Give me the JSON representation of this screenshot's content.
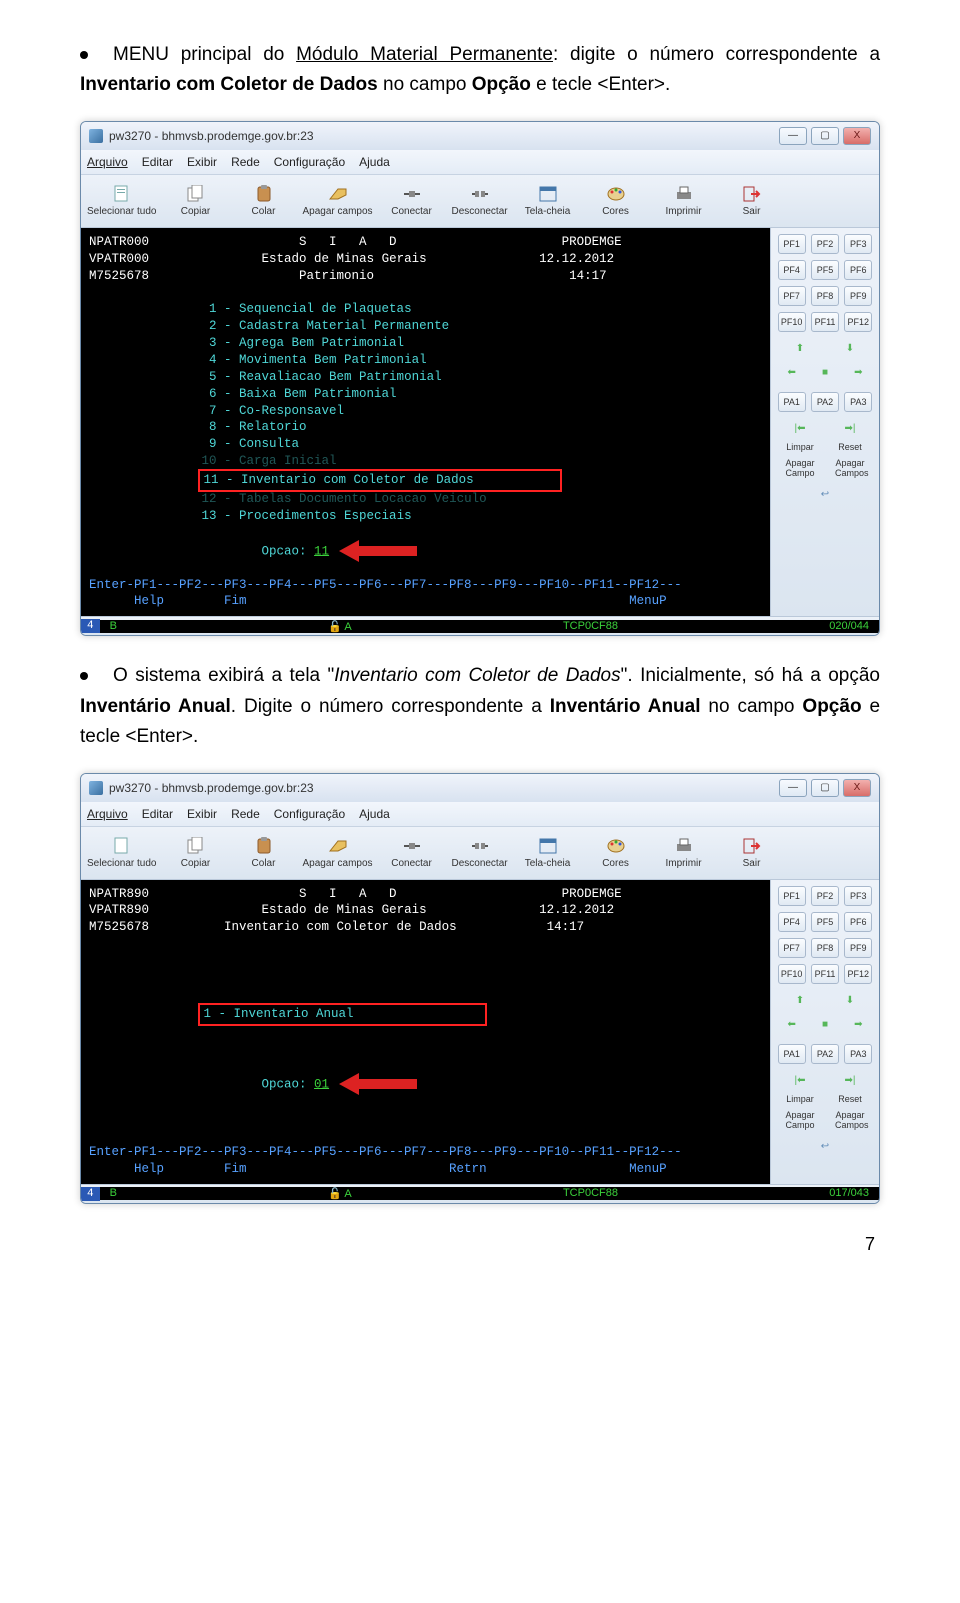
{
  "intro1": {
    "prefix": "MENU principal do ",
    "module": "Módulo Material Permanente",
    "mid": ": digite o número correspondente a ",
    "feature": "Inventario com Coletor de Dados",
    "campo": " no campo ",
    "opt": "Opção",
    "suffix": " e tecle <Enter>."
  },
  "intro2": {
    "p1": "O sistema exibirá a tela \"",
    "name": "Inventario com Coletor de Dados",
    "p2": "\". Inicialmente, só há a opção ",
    "anual": "Inventário Anual",
    "p3": ". Digite o número correspondente a ",
    "anual2": "Inventário Anual",
    "p4": " no campo ",
    "opt": "Opção",
    "p5": " e tecle <Enter>."
  },
  "window": {
    "title": "pw3270 - bhmvsb.prodemge.gov.br:23",
    "menubar": [
      "Arquivo",
      "Editar",
      "Exibir",
      "Rede",
      "Configuração",
      "Ajuda"
    ],
    "toolbar": [
      {
        "label": "Selecionar tudo",
        "svg": "doc"
      },
      {
        "label": "Copiar",
        "svg": "copy"
      },
      {
        "label": "Colar",
        "svg": "paste"
      },
      {
        "label": "Apagar campos",
        "svg": "eraser"
      },
      {
        "label": "Conectar",
        "svg": "plug"
      },
      {
        "label": "Desconectar",
        "svg": "unplug"
      },
      {
        "label": "Tela-cheia",
        "svg": "fullscreen"
      },
      {
        "label": "Cores",
        "svg": "palette"
      },
      {
        "label": "Imprimir",
        "svg": "print"
      },
      {
        "label": "Sair",
        "svg": "exit"
      }
    ],
    "side": {
      "pf": [
        [
          "PF1",
          "PF2",
          "PF3"
        ],
        [
          "PF4",
          "PF5",
          "PF6"
        ],
        [
          "PF7",
          "PF8",
          "PF9"
        ],
        [
          "PF10",
          "PF11",
          "PF12"
        ]
      ],
      "pa": [
        "PA1",
        "PA2",
        "PA3"
      ],
      "labels1": [
        "Limpar",
        "Reset"
      ],
      "labels2": [
        "Apagar Campo",
        "Apagar Campos"
      ]
    },
    "winbtns": {
      "min": "—",
      "max": "▢",
      "close": "X"
    }
  },
  "term1": {
    "h1": "NPATR000",
    "h2": "VPATR000",
    "h3": "M7525678",
    "title": "S   I   A   D",
    "sub": "Estado de Minas Gerais",
    "mod": "Patrimonio",
    "right1": "PRODEMGE",
    "right2": "12.12.2012",
    "right3": "14:17",
    "opts": [
      "1 - Sequencial de Plaquetas",
      "2 - Cadastra Material Permanente",
      "3 - Agrega Bem Patrimonial",
      "4 - Movimenta Bem Patrimonial",
      "5 - Reavaliacao Bem Patrimonial",
      "6 - Baixa Bem Patrimonial",
      "7 - Co-Responsavel",
      "8 - Relatorio",
      "9 - Consulta",
      "10 - Carga Inicial",
      "11 - Inventario com Coletor de Dados",
      "12 - Tabelas Documento Locacao Veiculo",
      "13 - Procedimentos Especiais"
    ],
    "opLabel": "Opcao: ",
    "opVal": "11",
    "footer1": "Enter-PF1---PF2---PF3---PF4---PF5---PF6---PF7---PF8---PF9---PF10--PF11--PF12---",
    "footer2": "      Help        Fim                                                   MenuP",
    "status": {
      "left": "4",
      "b": "B",
      "lock": "🔓",
      "a": "A",
      "tcp": "TCP0CF88",
      "pos": "020/044"
    }
  },
  "term2": {
    "h1": "NPATR890",
    "h2": "VPATR890",
    "h3": "M7525678",
    "title": "S   I   A   D",
    "sub": "Estado de Minas Gerais",
    "mod": "Inventario com Coletor de Dados",
    "right1": "PRODEMGE",
    "right2": "12.12.2012",
    "right3": "14:17",
    "opt1": "1 - Inventario Anual",
    "opLabel": "Opcao: ",
    "opVal": "01",
    "footer1": "Enter-PF1---PF2---PF3---PF4---PF5---PF6---PF7---PF8---PF9---PF10--PF11--PF12---",
    "footer2": "      Help        Fim                           Retrn                   MenuP",
    "status": {
      "left": "4",
      "b": "B",
      "lock": "🔓",
      "a": "A",
      "tcp": "TCP0CF88",
      "pos": "017/043"
    }
  },
  "page_num": "7"
}
